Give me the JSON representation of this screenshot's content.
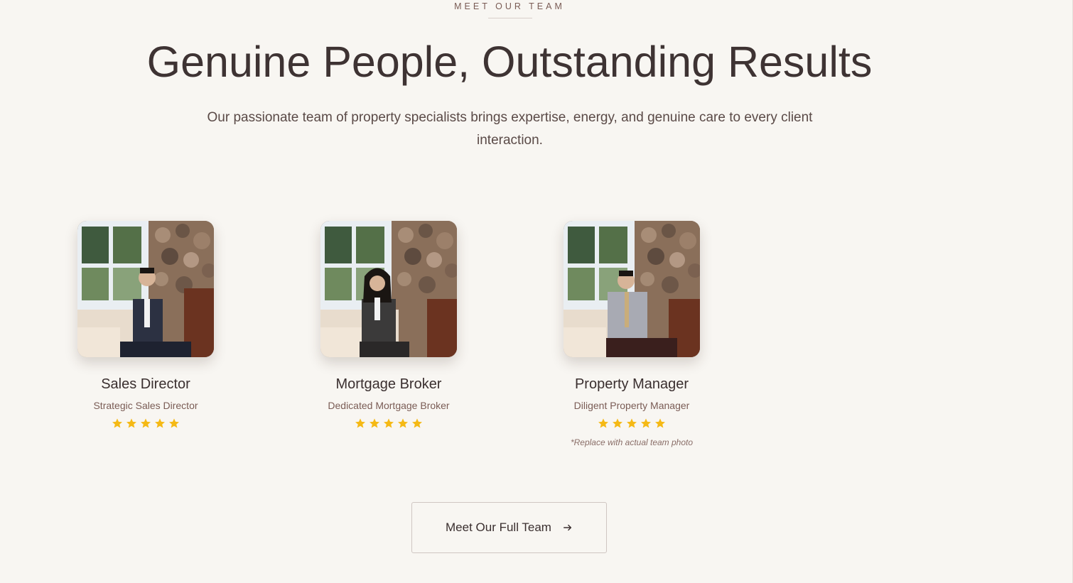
{
  "section": {
    "eyebrow": "MEET OUR TEAM",
    "headline": "Genuine People, Outstanding Results",
    "intro": "Our passionate team of property specialists brings expertise, energy, and genuine care to every client interaction."
  },
  "team": [
    {
      "name": "Sales Director",
      "role": "Strategic Sales Director",
      "rating": 5,
      "note": ""
    },
    {
      "name": "Mortgage Broker",
      "role": "Dedicated Mortgage Broker",
      "rating": 5,
      "note": ""
    },
    {
      "name": "Property Manager",
      "role": "Diligent Property Manager",
      "rating": 5,
      "note": "*Replace with actual team photo"
    }
  ],
  "cta": {
    "label": "Meet Our Full Team",
    "icon": "arrow-right-icon"
  },
  "colors": {
    "background": "#f8f6f2",
    "heading": "#3e3333",
    "accent_text": "#7a5c55",
    "star": "#f5b915"
  }
}
